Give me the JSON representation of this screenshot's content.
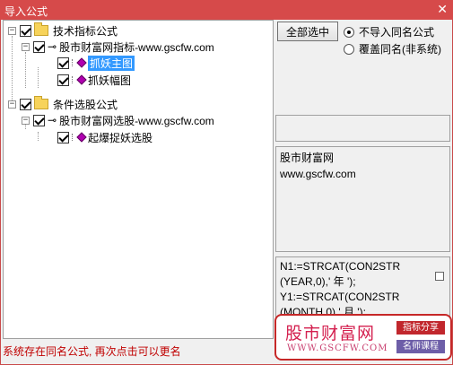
{
  "window": {
    "title": "导入公式",
    "close_glyph": "✕"
  },
  "tree": {
    "groups": [
      {
        "label": "技术指标公式",
        "formula_set": "股市财富网指标-www.gscfw.com",
        "items": [
          "抓妖主图",
          "抓妖幅图"
        ]
      },
      {
        "label": "条件选股公式",
        "formula_set": "股市财富网选股-www.gscfw.com",
        "items": [
          "起爆捉妖选股"
        ]
      }
    ],
    "selected_item": "抓妖主图",
    "expand_glyph": "−",
    "icons": {
      "group": "folder-icon",
      "set": "key-icon",
      "item": "formula-icon"
    }
  },
  "options": {
    "select_all_label": "全部选中",
    "radio_skip_label": "不导入同名公式",
    "radio_overwrite_label": "覆盖同名(非系统)",
    "selected_radio": "不导入同名公式"
  },
  "info": {
    "line1": "股市财富网",
    "line2": "www.gscfw.com"
  },
  "formula_preview": {
    "lines": [
      "N1:=STRCAT(CON2STR",
      "(YEAR,0),' 年 ');",
      "Y1:=STRCAT(CON2STR",
      "(MONTH,0),' 月 ');"
    ]
  },
  "status_text": "系统存在同名公式, 再次点击可以更名",
  "brand": {
    "name": "股市财富网",
    "url": "WWW.GSCFW.COM",
    "tag1": "指标分享",
    "tag2": "名师课程",
    "color_primary": "#c62828",
    "color_secondary": "#6d5ea8"
  }
}
